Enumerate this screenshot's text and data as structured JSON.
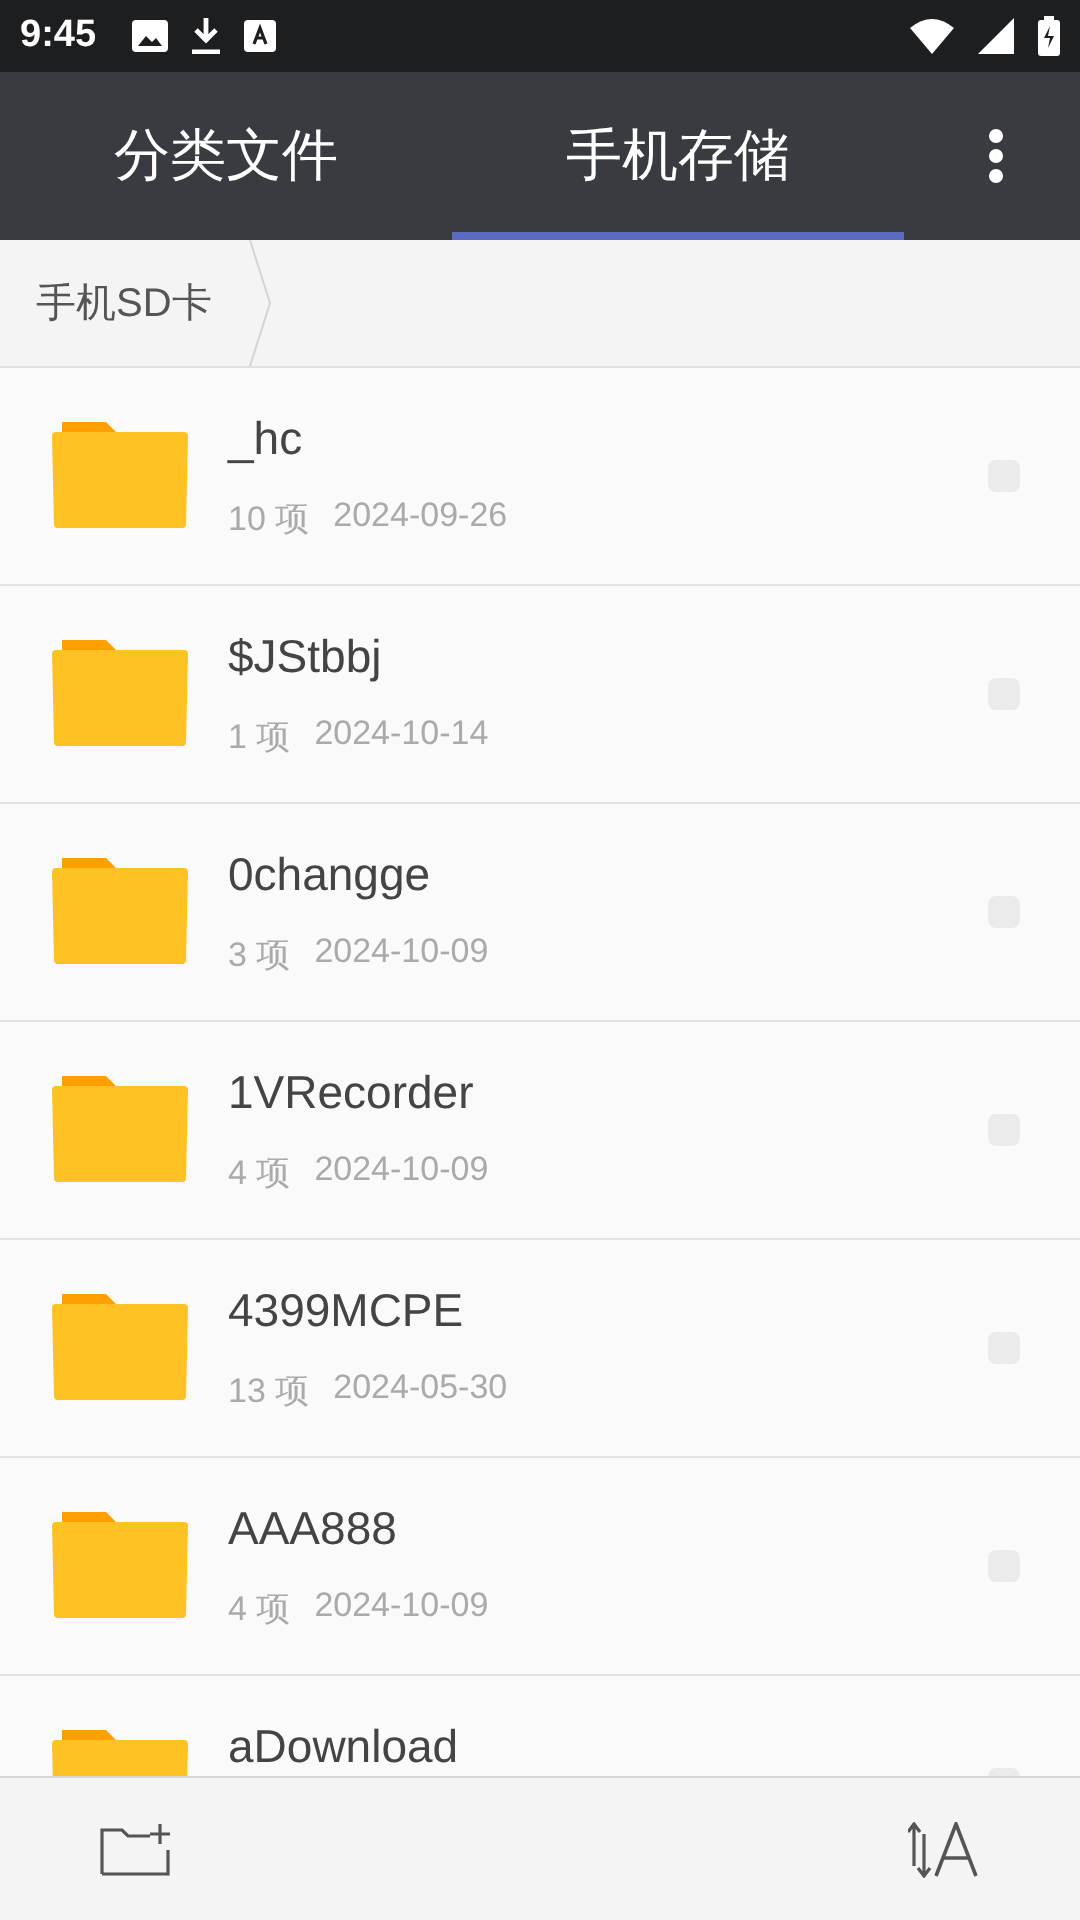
{
  "status_bar": {
    "time": "9:45"
  },
  "tabs": [
    {
      "label": "分类文件",
      "selected": false
    },
    {
      "label": "手机存储",
      "selected": true
    }
  ],
  "breadcrumb": [
    "手机SD卡"
  ],
  "files": [
    {
      "name": "_hc",
      "count": "10 项",
      "date": "2024-09-26",
      "checked": false
    },
    {
      "name": "$JStbbj",
      "count": "1 项",
      "date": "2024-10-14",
      "checked": false
    },
    {
      "name": "0changge",
      "count": "3 项",
      "date": "2024-10-09",
      "checked": false
    },
    {
      "name": "1VRecorder",
      "count": "4 项",
      "date": "2024-10-09",
      "checked": false
    },
    {
      "name": "4399MCPE",
      "count": "13 项",
      "date": "2024-05-30",
      "checked": false
    },
    {
      "name": "AAA888",
      "count": "4 项",
      "date": "2024-10-09",
      "checked": false
    },
    {
      "name": "aDownload",
      "checked": false
    }
  ]
}
